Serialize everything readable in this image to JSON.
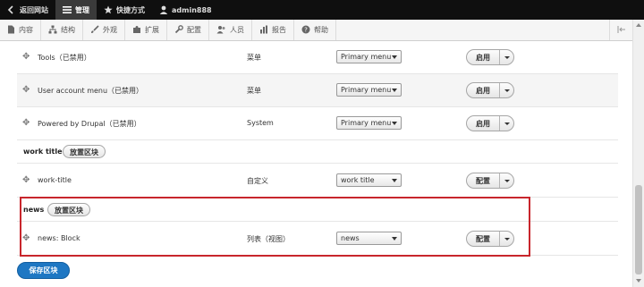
{
  "toolbar": {
    "back_label": "返回网站",
    "manage_label": "管理",
    "shortcuts_label": "快捷方式",
    "user_label": "admin888"
  },
  "tray": {
    "items": [
      {
        "label": "内容",
        "icon": "file-icon"
      },
      {
        "label": "结构",
        "icon": "sitemap-icon"
      },
      {
        "label": "外观",
        "icon": "brush-icon"
      },
      {
        "label": "扩展",
        "icon": "puzzle-icon"
      },
      {
        "label": "配置",
        "icon": "wrench-icon"
      },
      {
        "label": "人员",
        "icon": "people-icon"
      },
      {
        "label": "报告",
        "icon": "bar-chart-icon"
      },
      {
        "label": "帮助",
        "icon": "help-icon"
      }
    ]
  },
  "rows": [
    {
      "title": "Tools（已禁用）",
      "category": "菜单",
      "region": "Primary menu",
      "action": "启用"
    },
    {
      "title": "User account menu（已禁用）",
      "category": "菜单",
      "region": "Primary menu",
      "action": "启用"
    },
    {
      "title": "Powered by Drupal（已禁用）",
      "category": "System",
      "region": "Primary menu",
      "action": "启用"
    }
  ],
  "regions": [
    {
      "name": "work title",
      "place_label": "放置区块"
    },
    {
      "name": "news",
      "place_label": "放置区块"
    }
  ],
  "work_row": {
    "title": "work-title",
    "category": "自定义",
    "region": "work title",
    "action": "配置"
  },
  "news_row": {
    "title": "news: Block",
    "category": "列表（视图）",
    "region": "news",
    "action": "配置"
  },
  "save_label": "保存区块",
  "colors": {
    "toolbar_bg": "#0f0f0f",
    "primary_button": "#1e77c3",
    "highlight": "#c8262c"
  }
}
